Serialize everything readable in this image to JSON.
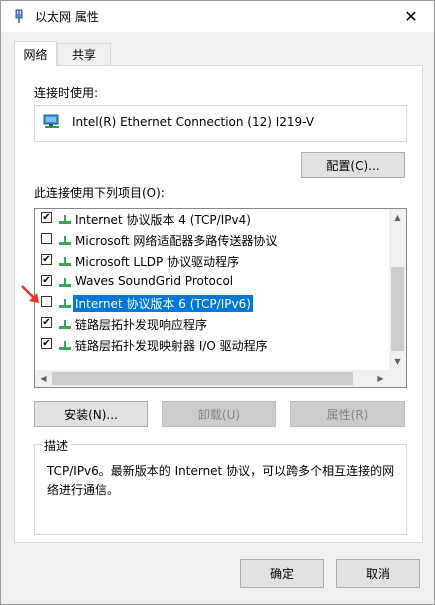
{
  "window": {
    "title": "以太网 属性",
    "close_glyph": "✕"
  },
  "tabs": [
    {
      "label": "网络"
    },
    {
      "label": "共享"
    }
  ],
  "connect_using": {
    "label": "连接时使用:",
    "adapter": "Intel(R) Ethernet Connection (12) I219-V",
    "configure_button": "配置(C)..."
  },
  "items_section": {
    "label": "此连接使用下列项目(O):",
    "items": [
      {
        "label": "Internet 协议版本 4 (TCP/IPv4)",
        "checked": true,
        "selected": false
      },
      {
        "label": "Microsoft 网络适配器多路传送器协议",
        "checked": false,
        "selected": false
      },
      {
        "label": "Microsoft LLDP 协议驱动程序",
        "checked": true,
        "selected": false
      },
      {
        "label": "Waves SoundGrid Protocol",
        "checked": true,
        "selected": false
      },
      {
        "label": "Internet 协议版本 6 (TCP/IPv6)",
        "checked": false,
        "selected": true
      },
      {
        "label": "链路层拓扑发现响应程序",
        "checked": true,
        "selected": false
      },
      {
        "label": "链路层拓扑发现映射器 I/O 驱动程序",
        "checked": true,
        "selected": false
      }
    ]
  },
  "actions": {
    "install": "安装(N)...",
    "uninstall": "卸载(U)",
    "properties": "属性(R)"
  },
  "description": {
    "title": "描述",
    "text": "TCP/IPv6。最新版本的 Internet 协议，可以跨多个相互连接的网络进行通信。"
  },
  "footer": {
    "ok": "确定",
    "cancel": "取消"
  },
  "colors": {
    "accent": "#0078d7",
    "icon_green": "#3aa655",
    "annotation_arrow": "#e8312b"
  }
}
